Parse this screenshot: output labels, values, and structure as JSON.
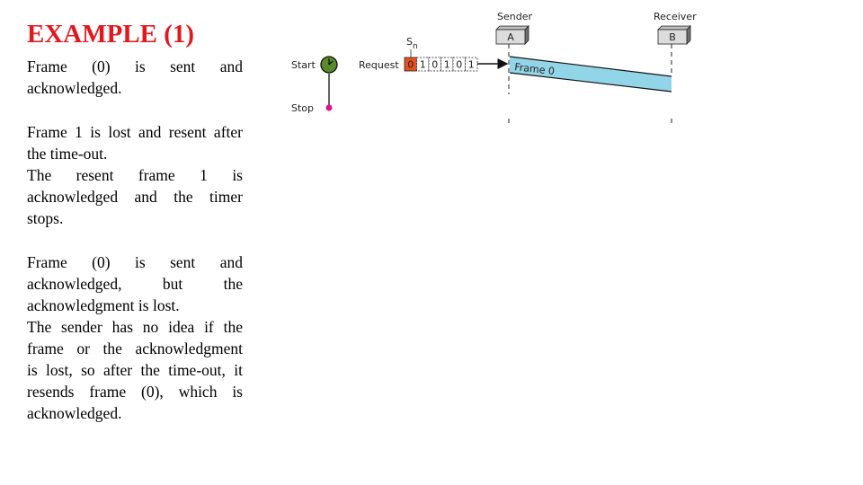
{
  "slide": {
    "title": "EXAMPLE (1)",
    "paragraphs": [
      {
        "lines": [
          "Frame (0) is sent and",
          "acknowledged."
        ]
      },
      {
        "lines": [
          "Frame 1 is lost and resent after",
          "the time-out.",
          "The resent frame 1 is",
          "acknowledged and the timer",
          "stops."
        ]
      },
      {
        "lines": [
          "Frame (0) is sent and",
          "acknowledged, but the",
          "acknowledgment is lost.",
          "The sender has no idea if the",
          "frame or the acknowledgment",
          "is lost, so after the time-out, it",
          "resends frame (0), which is",
          "acknowledged."
        ]
      }
    ]
  },
  "diagram": {
    "timer": {
      "start_label": "Start",
      "stop_label": "Stop",
      "icon": "clock-icon",
      "clock_color": "#5a8a2a",
      "stop_dot_color": "#e0138c"
    },
    "request": {
      "label": "Request",
      "sn_label": "S",
      "sn_subscript": "n",
      "sequence": [
        "0",
        "1",
        "0",
        "1",
        "0",
        "1"
      ],
      "current_index": 0,
      "current_color": "#e8501e"
    },
    "sender": {
      "role_label": "Sender",
      "box_label": "A"
    },
    "receiver": {
      "role_label": "Receiver",
      "box_label": "B"
    },
    "frame": {
      "label": "Frame 0",
      "color": "#93d5e8"
    }
  }
}
